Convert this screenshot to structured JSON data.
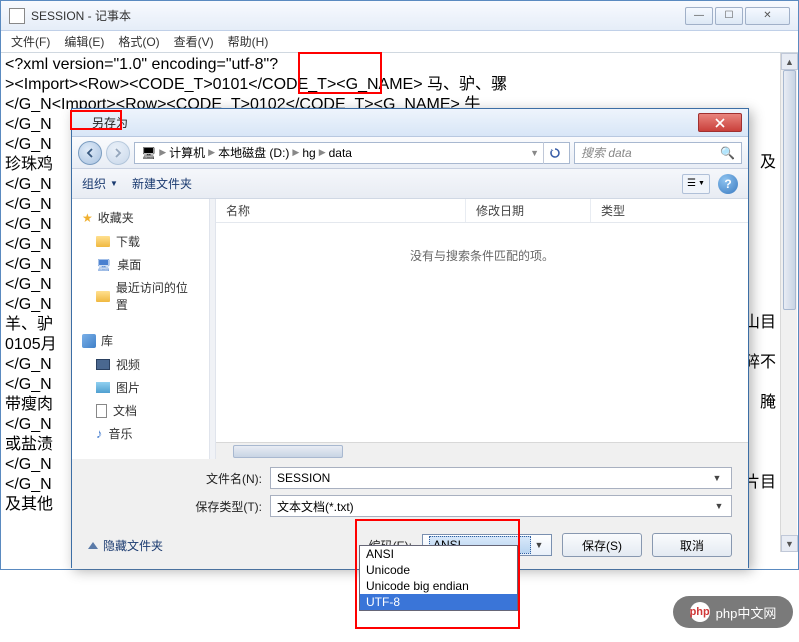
{
  "notepad": {
    "title": "SESSION - 记事本",
    "menu": {
      "file": "文件(F)",
      "edit": "编辑(E)",
      "format": "格式(O)",
      "view": "查看(V)",
      "help": "帮助(H)"
    },
    "lines": {
      "l1": "<?xml version=\"1.0\" encoding=\"utf-8\"?",
      "l2": "><Import><Row><CODE_T>0101</CODE_T><G_NAME> 马、驴、骡",
      "l3": "</G_N<Import><Row><CODE_T>0102</CODE_T><G_NAME> 牛",
      "l4": "</G_N",
      "l5": "</G_N",
      "l6": "珍珠鸡",
      "l7": "</G_N",
      "l8": "</G_N",
      "l9": "</G_N",
      "l10": "</G_N",
      "l11": "</G_N",
      "l12": "</G_N",
      "l13": "</G_N",
      "l14": "羊、驴",
      "l15": "0105月",
      "l16": "</G_N",
      "l17": "</G_N",
      "l18": "带瘦肉",
      "l19": "</G_N",
      "l20": "或盐渍",
      "l21": "</G_N",
      "l22": "</G_N",
      "l23": "及其他",
      "r1": "及",
      "r2": "山目",
      "r3": "碎不",
      "r4": "腌",
      "r5": "片目"
    }
  },
  "saveas": {
    "title": "另存为",
    "breadcrumb": {
      "seg1": "计算机",
      "seg2": "本地磁盘 (D:)",
      "seg3": "hg",
      "seg4": "data"
    },
    "search_placeholder": "搜索 data",
    "toolbar": {
      "organize": "组织",
      "newfolder": "新建文件夹"
    },
    "sidebar": {
      "favorites": "收藏夹",
      "downloads": "下载",
      "desktop": "桌面",
      "recent": "最近访问的位置",
      "libraries": "库",
      "videos": "视频",
      "pictures": "图片",
      "documents": "文档",
      "music": "音乐"
    },
    "cols": {
      "name": "名称",
      "date": "修改日期",
      "type": "类型"
    },
    "empty_msg": "没有与搜索条件匹配的项。",
    "filename_label": "文件名(N):",
    "filename_value": "SESSION",
    "filetype_label": "保存类型(T):",
    "filetype_value": "文本文档(*.txt)",
    "hide_folders": "隐藏文件夹",
    "encoding_label": "编码(E):",
    "encoding_selected": "ANSI",
    "encoding_options": {
      "o1": "ANSI",
      "o2": "Unicode",
      "o3": "Unicode big endian",
      "o4": "UTF-8"
    },
    "save_btn": "保存(S)",
    "cancel_btn": "取消"
  },
  "watermark": "php中文网"
}
